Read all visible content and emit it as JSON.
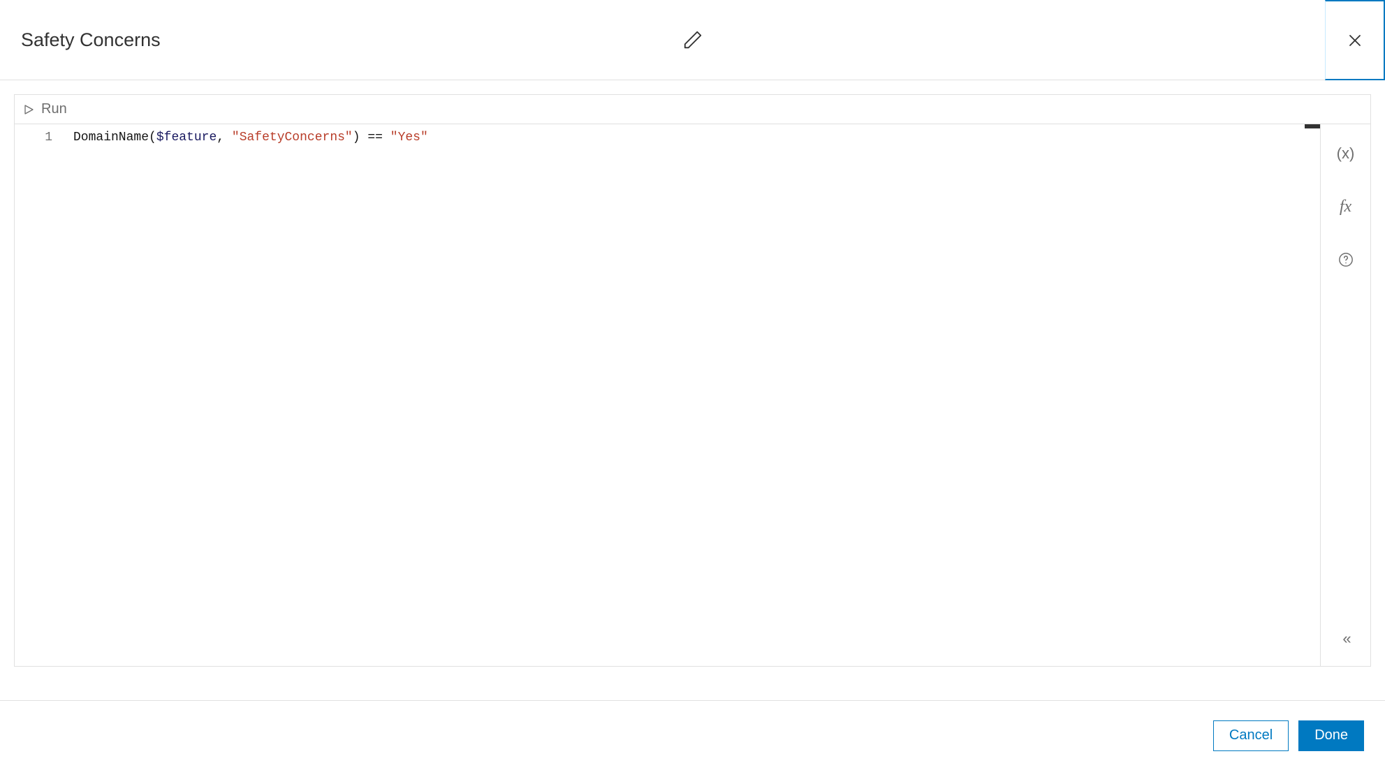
{
  "header": {
    "title": "Safety Concerns"
  },
  "toolbar": {
    "run_label": "Run"
  },
  "editor": {
    "line_number": "1",
    "code": {
      "func": "DomainName",
      "lparen": "(",
      "var": "$feature",
      "comma": ",",
      "space": " ",
      "str1": "\"SafetyConcerns\"",
      "rparen": ")",
      "sp2": " ",
      "op": "==",
      "sp3": " ",
      "str2": "\"Yes\""
    }
  },
  "side": {
    "vars_label": "(x)",
    "fx_label": "fx",
    "collapse_label": "«"
  },
  "footer": {
    "cancel_label": "Cancel",
    "done_label": "Done"
  }
}
